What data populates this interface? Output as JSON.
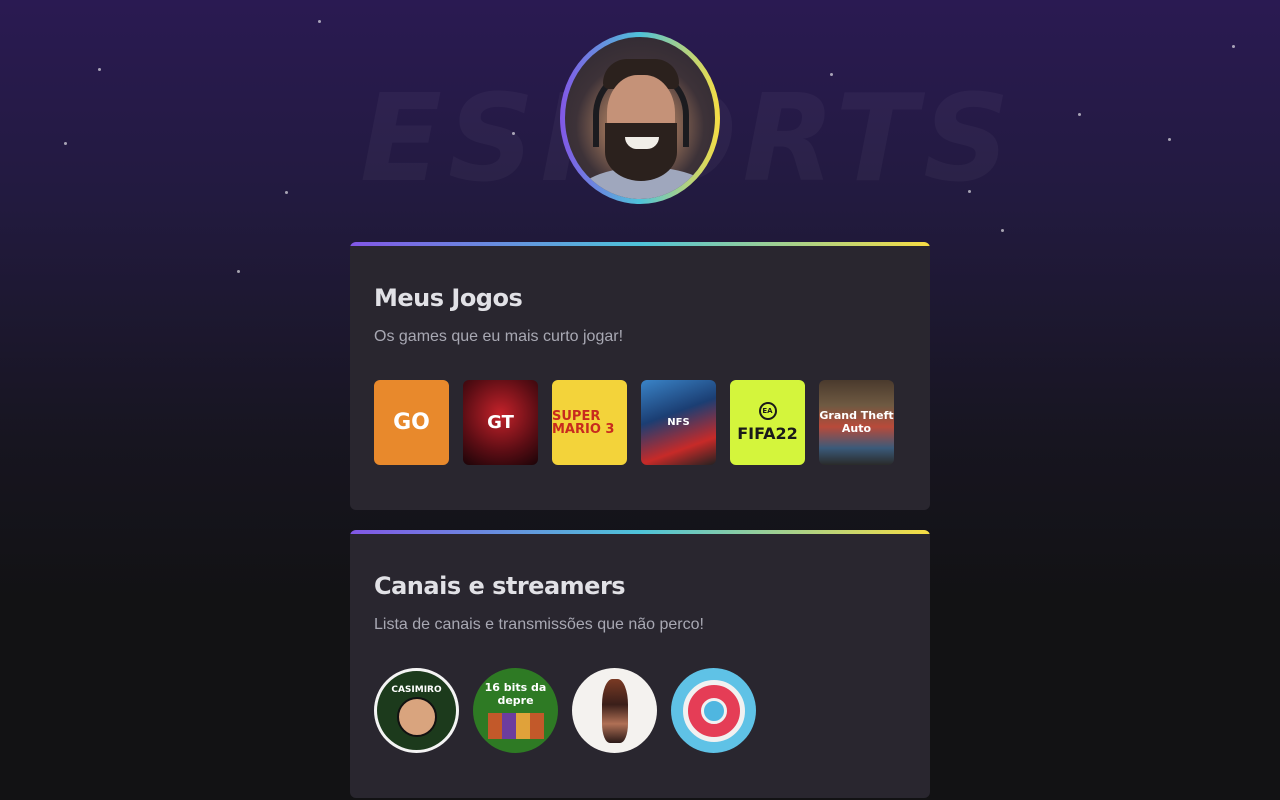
{
  "background": {
    "watermark_text": "ESPORTS"
  },
  "profile": {
    "avatar_alt": "profile-photo"
  },
  "games_section": {
    "title": "Meus Jogos",
    "subtitle": "Os games que eu mais curto jogar!",
    "games": [
      {
        "name": "counter-strike-go",
        "label": "GO"
      },
      {
        "name": "gran-turismo-sport",
        "label": "GT"
      },
      {
        "name": "super-mario-bros-3",
        "label": "SUPER MARIO 3"
      },
      {
        "name": "need-for-speed-underground",
        "label": "NFS"
      },
      {
        "name": "fifa-22",
        "label": "FIFA22",
        "badge": "EA"
      },
      {
        "name": "gta-v",
        "label": "Grand Theft Auto"
      }
    ]
  },
  "channels_section": {
    "title": "Canais e streamers",
    "subtitle": "Lista de canais e transmissões que não perco!",
    "channels": [
      {
        "name": "casimiro",
        "label": "CASIMIRO"
      },
      {
        "name": "16-bits-da-depre",
        "label": "16 bits da depre"
      },
      {
        "name": "artist-channel"
      },
      {
        "name": "diver-helmet-channel"
      }
    ]
  },
  "colors": {
    "accent_gradient": [
      "#8257e6",
      "#4ec3d9",
      "#f7dd43"
    ],
    "card_bg": "#29262f",
    "page_bg": "#121214"
  }
}
